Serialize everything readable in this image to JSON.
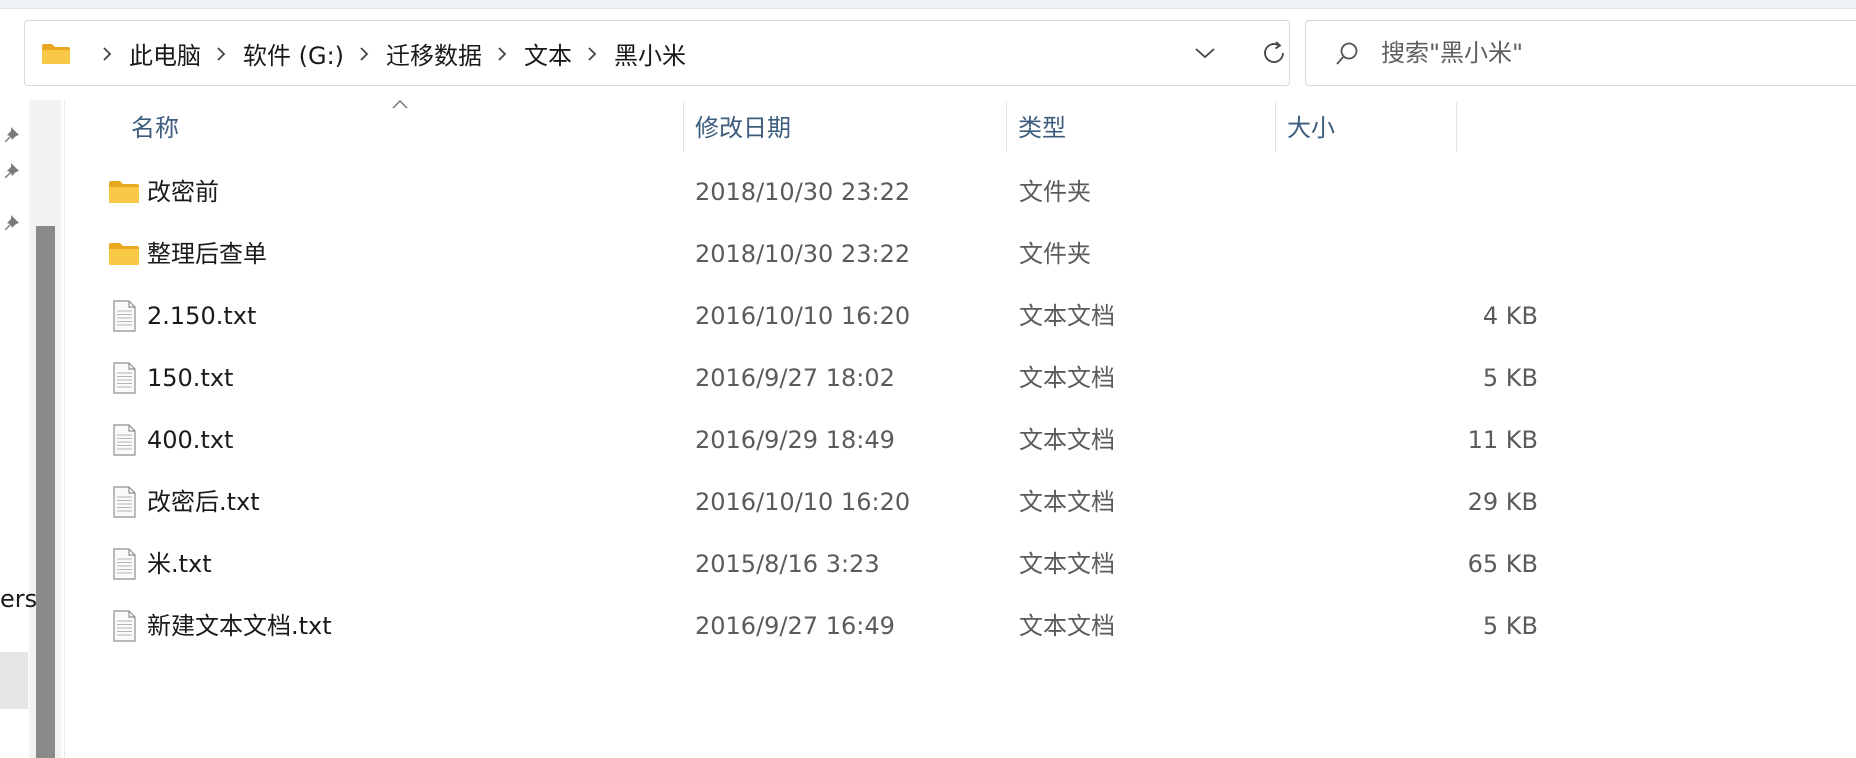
{
  "breadcrumb": {
    "items": [
      "此电脑",
      "软件 (G:)",
      "迁移数据",
      "文本",
      "黑小米"
    ]
  },
  "search": {
    "placeholder": "搜索\"黑小米\""
  },
  "nav": {
    "partial_label": "ers"
  },
  "columns": {
    "name": "名称",
    "date": "修改日期",
    "type": "类型",
    "size": "大小"
  },
  "files": [
    {
      "name": "改密前",
      "date": "2018/10/30 23:22",
      "type": "文件夹",
      "size": "",
      "icon": "folder-icon"
    },
    {
      "name": "整理后查单",
      "date": "2018/10/30 23:22",
      "type": "文件夹",
      "size": "",
      "icon": "folder-icon"
    },
    {
      "name": "2.150.txt",
      "date": "2016/10/10 16:20",
      "type": "文本文档",
      "size": "4 KB",
      "icon": "text-file-icon"
    },
    {
      "name": "150.txt",
      "date": "2016/9/27 18:02",
      "type": "文本文档",
      "size": "5 KB",
      "icon": "text-file-icon"
    },
    {
      "name": "400.txt",
      "date": "2016/9/29 18:49",
      "type": "文本文档",
      "size": "11 KB",
      "icon": "text-file-icon"
    },
    {
      "name": "改密后.txt",
      "date": "2016/10/10 16:20",
      "type": "文本文档",
      "size": "29 KB",
      "icon": "text-file-icon"
    },
    {
      "name": "米.txt",
      "date": "2015/8/16 3:23",
      "type": "文本文档",
      "size": "65 KB",
      "icon": "text-file-icon"
    },
    {
      "name": "新建文本文档.txt",
      "date": "2016/9/27 16:49",
      "type": "文本文档",
      "size": "5 KB",
      "icon": "text-file-icon"
    }
  ],
  "colors": {
    "folder": "#f8c846",
    "header_text": "#3d5d7e",
    "scroll_thumb": "#8a8a8a"
  }
}
